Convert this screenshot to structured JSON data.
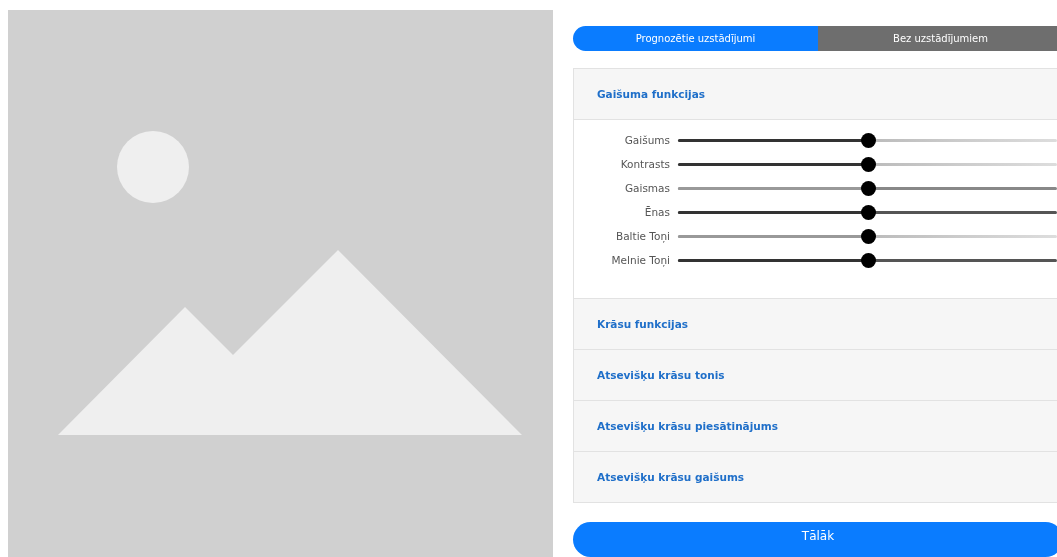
{
  "tabs": [
    {
      "label": "Prognozētie uzstādījumi",
      "selected": true
    },
    {
      "label": "Bez uzstādījumiem",
      "selected": false
    }
  ],
  "sections": [
    {
      "title": "Gaišuma funkcijas",
      "sliders": [
        {
          "label": "Gaišums",
          "level": 0.5
        },
        {
          "label": "Kontrasts",
          "level": 0.5
        },
        {
          "label": "Gaismas",
          "level": 0.5
        },
        {
          "label": "Ēnas",
          "level": 0.5
        },
        {
          "label": "Baltie Toņi",
          "level": 0.5
        },
        {
          "label": "Melnie Toņi",
          "level": 0.5
        }
      ]
    },
    {
      "title": "Krāsu funkcijas"
    },
    {
      "title": "Atsevišķu krāsu tonis"
    },
    {
      "title": "Atsevišķu krāsu piesātinājums"
    },
    {
      "title": "Atsevišķu krāsu gaišums"
    }
  ],
  "next_button": "Tālāk"
}
